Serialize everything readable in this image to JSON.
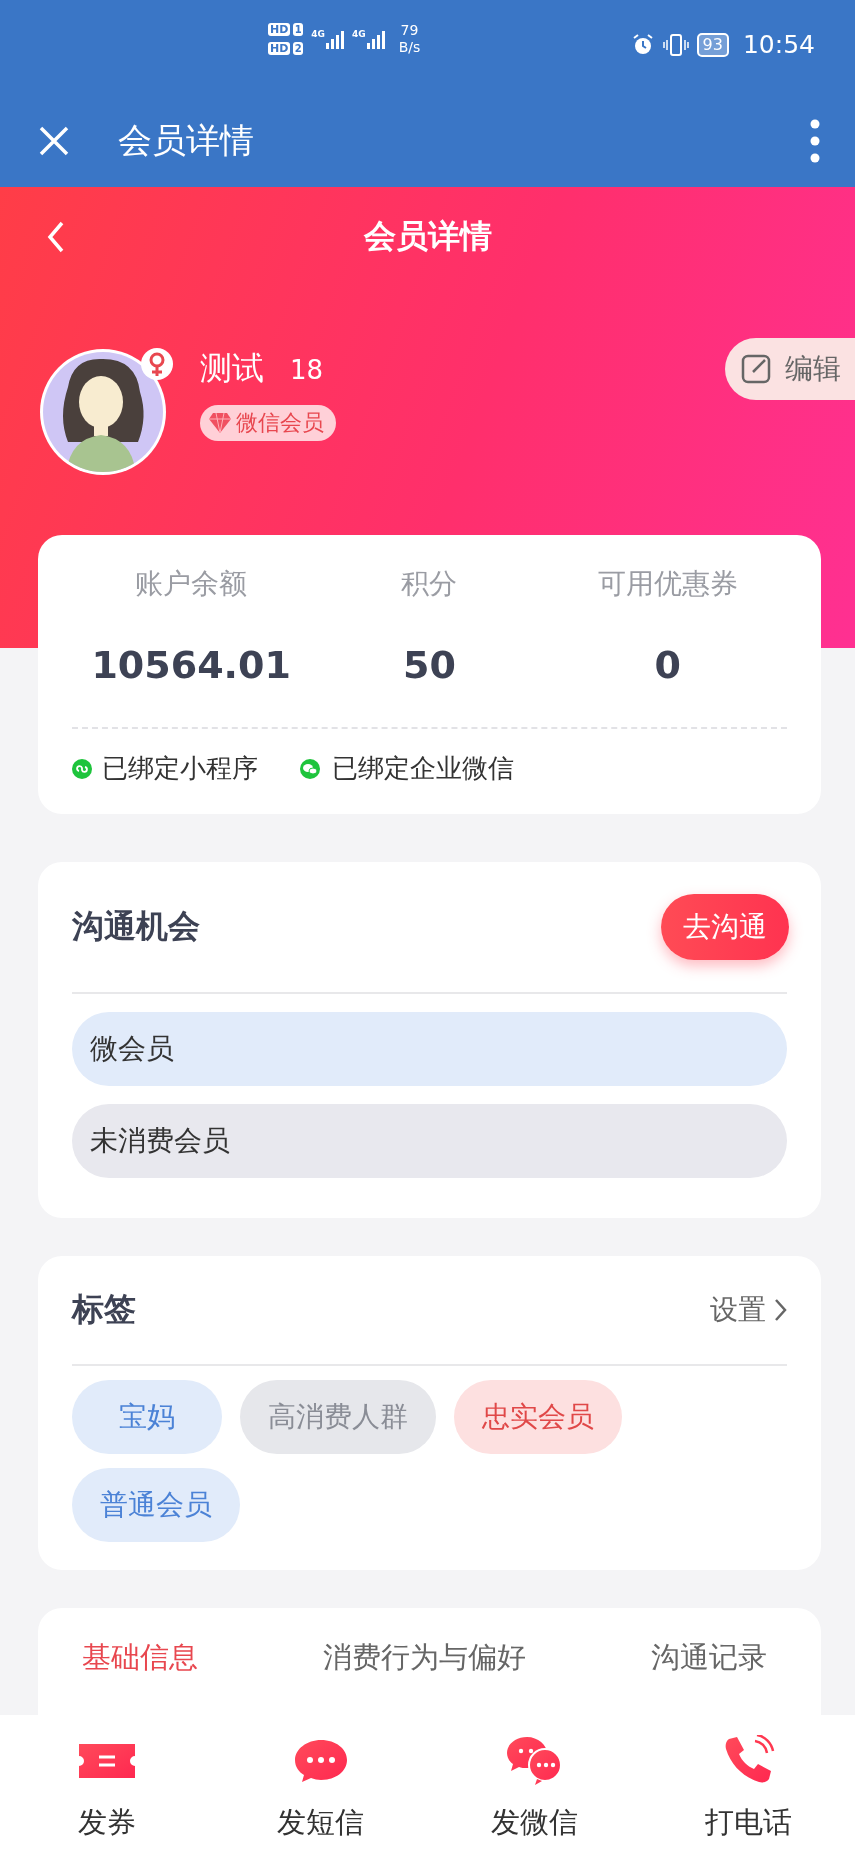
{
  "status_bar": {
    "sims": [
      {
        "label": "HD",
        "slot": "1"
      },
      {
        "label": "HD",
        "slot": "2"
      }
    ],
    "networks": [
      "4G",
      "4G"
    ],
    "speed": "79",
    "speed_unit": "B/s",
    "battery": "93",
    "time": "10:54"
  },
  "app_bar": {
    "title": "会员详情"
  },
  "page_header": {
    "title": "会员详情"
  },
  "member": {
    "name": "测试",
    "phone": "18",
    "badge": "微信会员",
    "edit_button": "编辑"
  },
  "stats": [
    {
      "label": "账户余额",
      "value": "10564.01"
    },
    {
      "label": "积分",
      "value": "50"
    },
    {
      "label": "可用优惠券",
      "value": "0"
    }
  ],
  "bindings": [
    {
      "label": "已绑定小程序",
      "kind": "miniprogram"
    },
    {
      "label": "已绑定企业微信",
      "kind": "wecom"
    }
  ],
  "opportunities": {
    "title": "沟通机会",
    "action": "去沟通",
    "items": [
      {
        "label": "微会员",
        "color": "#e1ebfa"
      },
      {
        "label": "未消费会员",
        "color": "#e8e8ee"
      }
    ]
  },
  "tags": {
    "title": "标签",
    "action": "设置",
    "items": [
      {
        "label": "宝妈",
        "color": "#e1ebfa"
      },
      {
        "label": "高消费人群",
        "color": "#e6e7eb"
      },
      {
        "label": "忠实会员",
        "color": "#fde0e0"
      },
      {
        "label": "普通会员",
        "color": "#e1ebfa"
      }
    ]
  },
  "detail_tabs": [
    {
      "label": "基础信息",
      "selected": true
    },
    {
      "label": "消费行为与偏好",
      "selected": false
    },
    {
      "label": "沟通记录",
      "selected": false
    }
  ],
  "bottom_nav": [
    {
      "label": "发券",
      "kind": "coupon"
    },
    {
      "label": "发短信",
      "kind": "sms"
    },
    {
      "label": "发微信",
      "kind": "wechat"
    },
    {
      "label": "打电话",
      "kind": "phone"
    }
  ]
}
